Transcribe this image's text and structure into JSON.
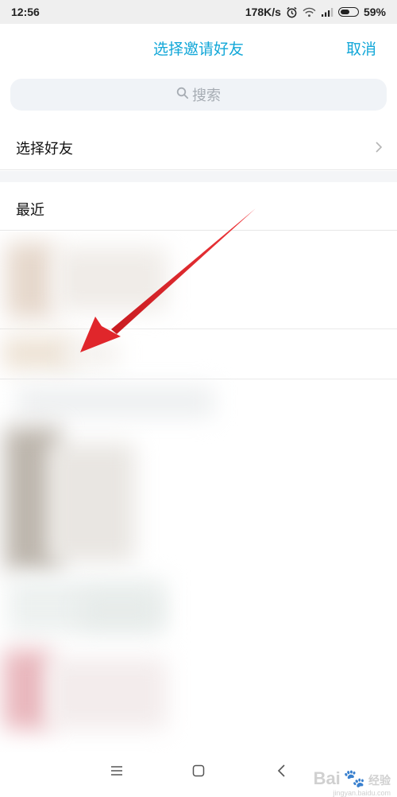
{
  "status_bar": {
    "time": "12:56",
    "network_speed": "178K/s",
    "battery_percent": "59%",
    "battery_level": 0.59
  },
  "nav": {
    "title": "选择邀请好友",
    "cancel_label": "取消"
  },
  "search": {
    "placeholder": "搜索"
  },
  "rows": {
    "select_friends": "选择好友",
    "recent": "最近"
  },
  "colors": {
    "accent": "#12a7d8",
    "arrow": "#e8262a"
  },
  "watermark": {
    "text_a": "Bai",
    "text_b": "经验",
    "url": "jingyan.baidu.com"
  }
}
